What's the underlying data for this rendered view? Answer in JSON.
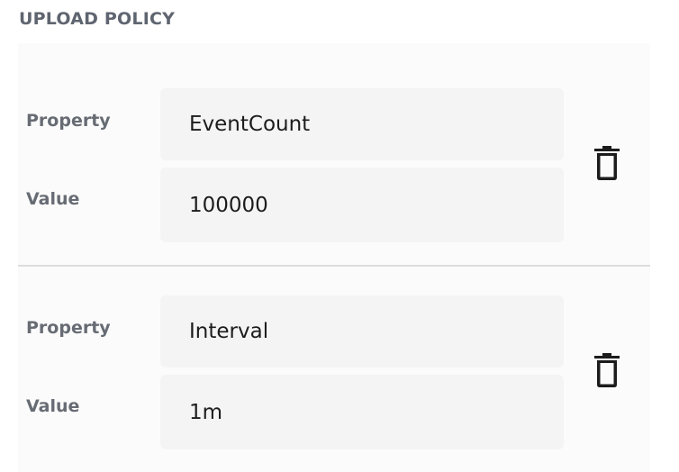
{
  "section": {
    "title": "UPLOAD POLICY"
  },
  "rows": [
    {
      "property_label": "Property",
      "property_value": "EventCount",
      "value_label": "Value",
      "value_value": "100000",
      "delete_icon": "trash-icon"
    },
    {
      "property_label": "Property",
      "property_value": "Interval",
      "value_label": "Value",
      "value_value": "1m",
      "delete_icon": "trash-icon"
    }
  ],
  "colors": {
    "title": "#5f6570",
    "label": "#676c74",
    "input_bg": "#f4f4f4",
    "row_bg": "#fbfbfb",
    "divider": "#dcdcdc",
    "icon": "#1c1c1c"
  }
}
